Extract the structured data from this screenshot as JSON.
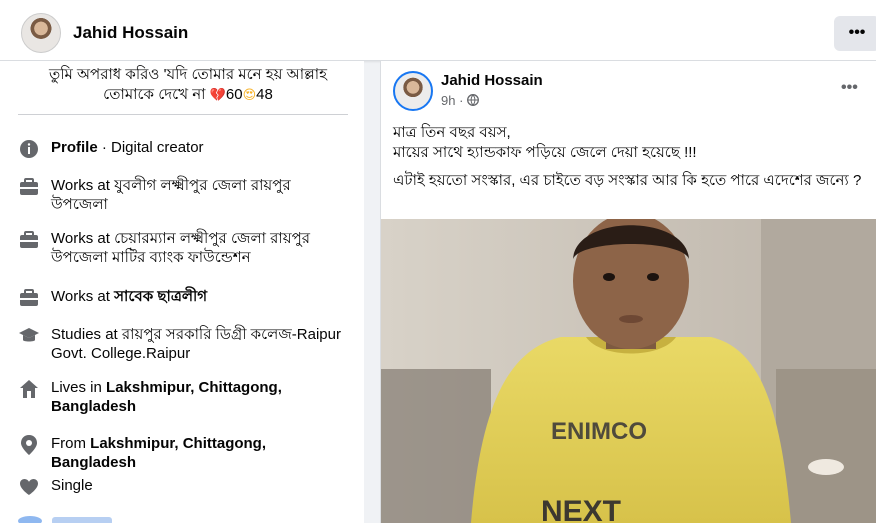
{
  "header": {
    "name": "Jahid Hossain",
    "more_label": "•••"
  },
  "intro": {
    "quote_line1": "তুমি অপরাধ করিও 'যদি তোমার মনে হয় আল্লাহ",
    "quote_line2_text": "তোমাকে দেখে না",
    "broken_heart_count": "60",
    "love_count": "48"
  },
  "about": [
    {
      "icon": "info-icon",
      "prefix": "Profile",
      "text": " · Digital creator",
      "bold": ""
    },
    {
      "icon": "briefcase-icon",
      "prefix": "Works at",
      "text": " যুবলীগ লক্ষ্মীপুর জেলা রায়পুর উপজেলা",
      "bold": ""
    },
    {
      "icon": "briefcase-icon",
      "prefix": "Works at",
      "text": " চেয়ারম্যান লক্ষ্মীপুর জেলা রায়পুর উপজেলা মাটির ব্যাংক ফাউন্ডেশন",
      "bold": ""
    },
    {
      "icon": "briefcase-icon",
      "prefix": "Works at",
      "text": " ",
      "bold": "সাবেক ছাত্রলীগ"
    },
    {
      "icon": "graduation-cap-icon",
      "prefix": "Studies at",
      "text": " রায়পুর সরকারি ডিগ্রী কলেজ-Raipur Govt. College.Raipur",
      "bold": ""
    },
    {
      "icon": "home-icon",
      "prefix": "Lives in",
      "text": " ",
      "bold": "Lakshmipur, Chittagong, Bangladesh"
    },
    {
      "icon": "location-pin-icon",
      "prefix": "From",
      "text": " ",
      "bold": "Lakshmipur, Chittagong, Bangladesh"
    },
    {
      "icon": "heart-icon",
      "prefix": "Single",
      "text": "",
      "bold": ""
    }
  ],
  "post": {
    "author": "Jahid Hossain",
    "time": "9h",
    "more_label": "•••",
    "line1": "মাত্র তিন বছর বয়স,",
    "line2": "মায়ের সাথে হ্যান্ডকাফ পড়িয়ে জেলে দেয়া হয়েছে !!!",
    "line3": "এটাই হয়তো সংস্কার, এর চাইতে বড় সংস্কার আর কি হতে পারে এদেশের জন্যে ?",
    "shirt_text": "ENIMCO",
    "shirt_text2": "NEXT"
  }
}
